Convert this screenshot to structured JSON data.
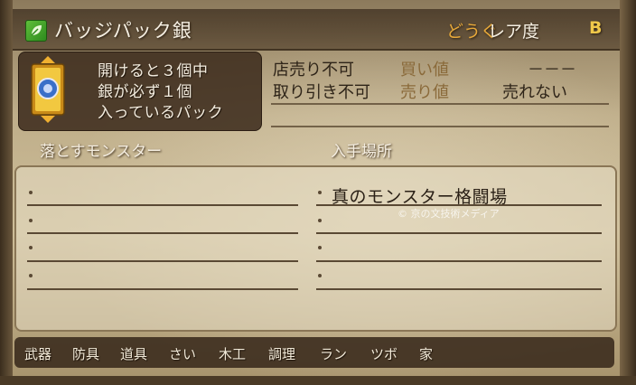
{
  "header": {
    "title": "バッジパック銀",
    "category": "どうぐ",
    "rarity_label": "レア度",
    "rarity_value": "B"
  },
  "description": [
    "開けると３個中",
    "銀が必ず１個",
    "入っているパック"
  ],
  "trade": {
    "shop_status": "店売り不可",
    "trade_status": "取り引き不可",
    "buy_label": "買い値",
    "buy_value": "－－－",
    "sell_label": "売り値",
    "sell_value": "売れない"
  },
  "sections": {
    "monsters_header": "落とすモンスター",
    "location_header": "入手場所"
  },
  "monsters": [
    "",
    "",
    "",
    ""
  ],
  "locations": [
    "真のモンスター格闘場",
    "",
    "",
    ""
  ],
  "watermark": "© 京の文技術メディア",
  "tabs": [
    "武器",
    "防具",
    "道具",
    "さい",
    "木工",
    "調理",
    "ラン",
    "ツボ",
    "家"
  ],
  "colors": {
    "category": "#e6a83a",
    "rarity": "#f0c84a",
    "price_label": "#8a6a3a"
  }
}
